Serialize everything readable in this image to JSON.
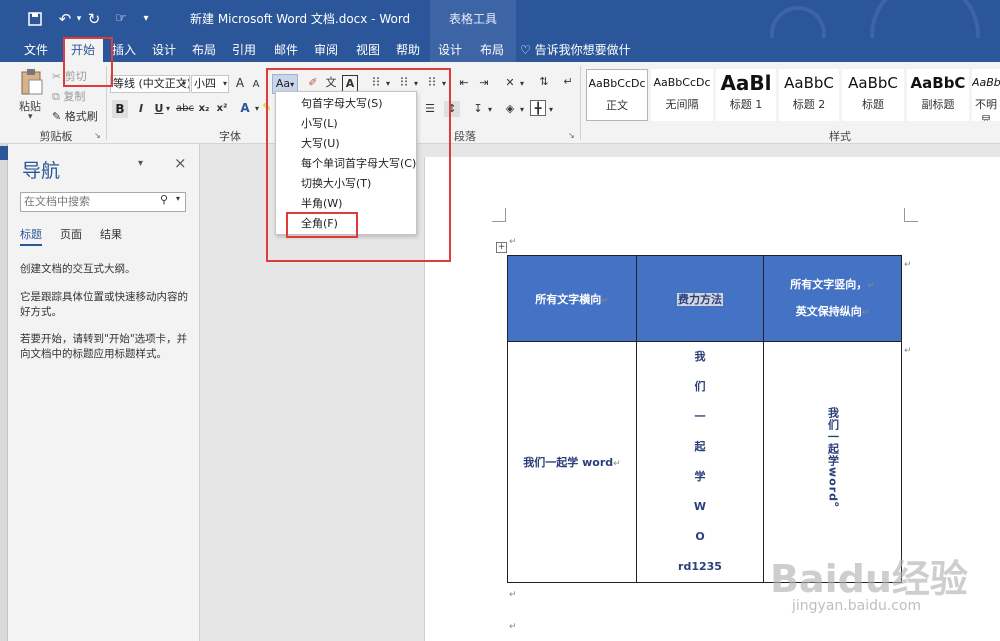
{
  "window": {
    "title": "新建 Microsoft Word 文档.docx  -  Word",
    "context_tab_group": "表格工具"
  },
  "ribbon_tabs": [
    {
      "label": "文件"
    },
    {
      "label": "开始"
    },
    {
      "label": "插入"
    },
    {
      "label": "设计"
    },
    {
      "label": "布局"
    },
    {
      "label": "引用"
    },
    {
      "label": "邮件"
    },
    {
      "label": "审阅"
    },
    {
      "label": "视图"
    },
    {
      "label": "帮助"
    },
    {
      "label": "设计"
    },
    {
      "label": "布局"
    }
  ],
  "tell_me": "告诉我你想要做什么",
  "clipboard": {
    "paste": "粘贴",
    "cut": "剪切",
    "copy": "复制",
    "format_painter": "格式刷",
    "group_label": "剪贴板"
  },
  "font": {
    "family": "等线 (中文正文)",
    "size": "小四",
    "change_case": "Aa",
    "group_label": "字体",
    "grow": "A",
    "shrink": "A",
    "bold": "B",
    "italic": "I",
    "underline": "U",
    "strike": "abc",
    "sub": "x₂",
    "sup": "x²"
  },
  "paragraph": {
    "group_label": "段落"
  },
  "styles": {
    "group_label": "样式",
    "items": [
      {
        "sample": "AaBbCcDc",
        "name": "正文"
      },
      {
        "sample": "AaBbCcDc",
        "name": "无间隔"
      },
      {
        "sample": "AaBl",
        "name": "标题 1"
      },
      {
        "sample": "AaBbC",
        "name": "标题 2"
      },
      {
        "sample": "AaBbC",
        "name": "标题"
      },
      {
        "sample": "AaBbC",
        "name": "副标题"
      },
      {
        "sample": "AaBbC",
        "name": "不明显"
      }
    ]
  },
  "case_menu": [
    {
      "label": "句首字母大写(S)"
    },
    {
      "label": "小写(L)"
    },
    {
      "label": "大写(U)"
    },
    {
      "label": "每个单词首字母大写(C)"
    },
    {
      "label": "切换大小写(T)"
    },
    {
      "label": "半角(W)"
    },
    {
      "label": "全角(F)"
    }
  ],
  "nav": {
    "title": "导航",
    "search_placeholder": "在文档中搜索",
    "tabs": [
      {
        "label": "标题"
      },
      {
        "label": "页面"
      },
      {
        "label": "结果"
      }
    ],
    "para1": "创建文档的交互式大纲。",
    "para2": "它是跟踪具体位置或快速移动内容的好方式。",
    "para3": "若要开始，请转到\"开始\"选项卡，并向文档中的标题应用标题样式。"
  },
  "table": {
    "headers": [
      "所有文字横向",
      "费力方法",
      "所有文字竖向，",
      "英文保持纵向"
    ],
    "cell_left": "我们一起学 word",
    "middle_chars": [
      "我",
      "们",
      "一",
      "起",
      "学",
      "W",
      "O",
      "rd1235"
    ],
    "cell_right": "我们一起学word。"
  },
  "watermark": {
    "brand": "Baidu经验",
    "url": "jingyan.baidu.com"
  }
}
